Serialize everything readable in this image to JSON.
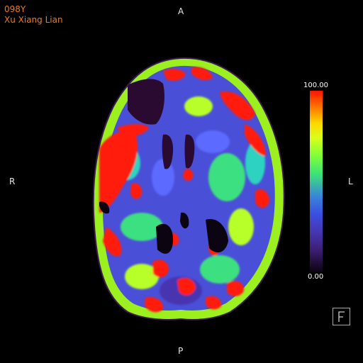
{
  "patient": {
    "age": "098Y",
    "name": "Xu Xiang Lian"
  },
  "orientation": {
    "anterior": "A",
    "posterior": "P",
    "right": "R",
    "left": "L"
  },
  "colorbar": {
    "max_label": "100.00",
    "min_label": "0.00"
  },
  "colors": {
    "overlay_text": "#f07a1c",
    "orientation_text": "#e6e6e6",
    "background": "#000000"
  },
  "icons": {
    "orientation_marker": "f-letter-icon"
  }
}
